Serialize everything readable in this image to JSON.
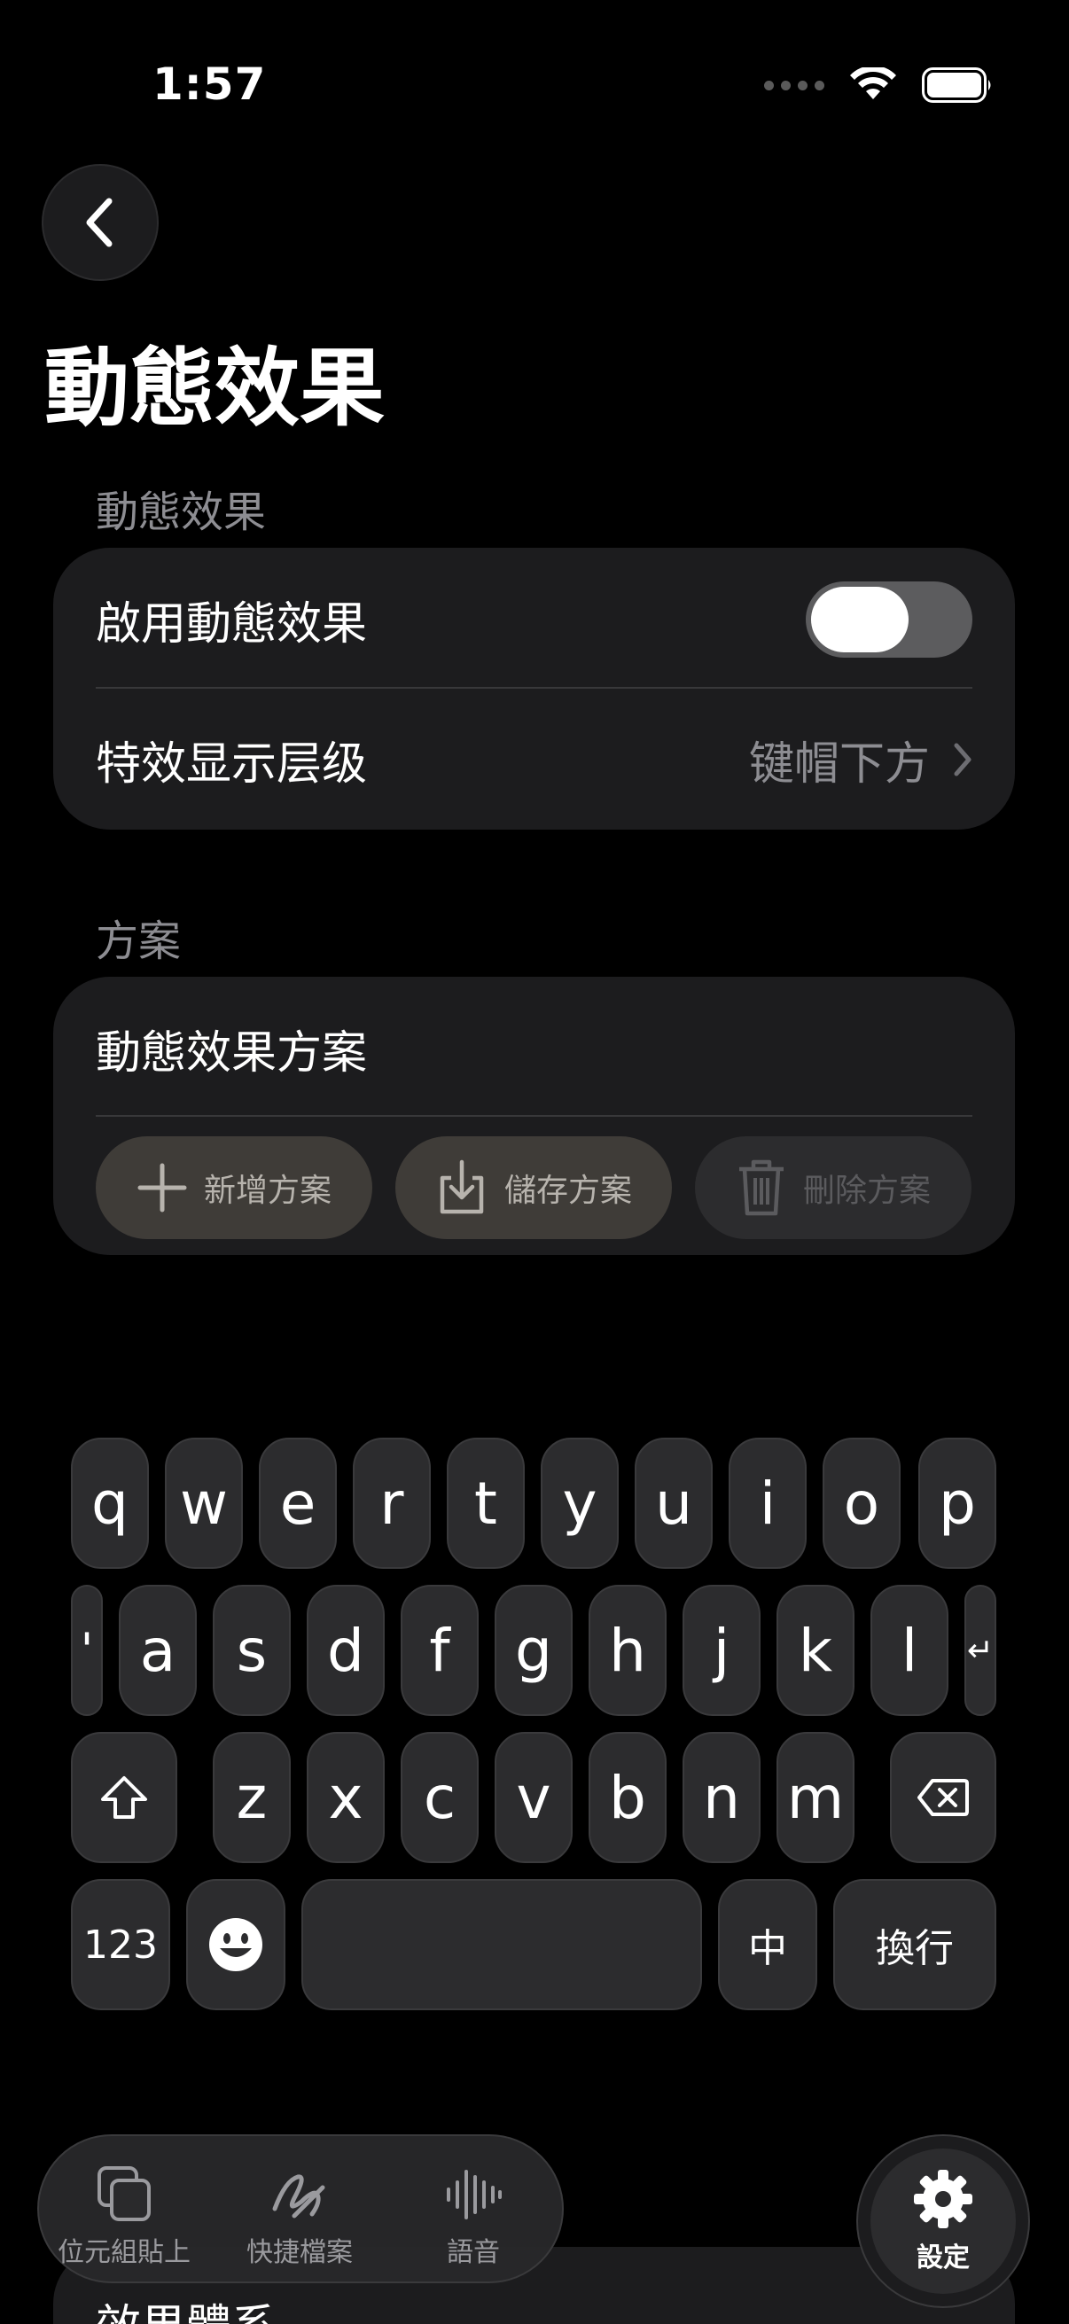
{
  "status_bar": {
    "time": "1:57"
  },
  "header": {
    "title": "動態效果"
  },
  "sections": {
    "motion": {
      "header": "動態效果",
      "enable_label": "啟用動態效果",
      "enable_on": false,
      "layer_label": "特效显示层级",
      "layer_value": "键帽下方"
    },
    "scheme": {
      "header": "方案",
      "name": "動態效果方案",
      "add_label": "新增方案",
      "save_label": "儲存方案",
      "delete_label": "刪除方案"
    },
    "peek": {
      "label": "效果體系"
    }
  },
  "keyboard": {
    "row1": [
      "q",
      "w",
      "e",
      "r",
      "t",
      "y",
      "u",
      "i",
      "o",
      "p"
    ],
    "row2": [
      "'",
      "a",
      "s",
      "d",
      "f",
      "g",
      "h",
      "j",
      "k",
      "l",
      "↵"
    ],
    "row3": [
      "z",
      "x",
      "c",
      "v",
      "b",
      "n",
      "m"
    ],
    "numbers_label": "123",
    "lang_label": "中",
    "return_label": "換行"
  },
  "tab_bar": {
    "tabs": [
      {
        "label": "位元組貼上",
        "icon": "paste-icon"
      },
      {
        "label": "快捷檔案",
        "icon": "scribble-icon"
      },
      {
        "label": "語音",
        "icon": "waveform-icon"
      }
    ],
    "settings_label": "設定"
  }
}
